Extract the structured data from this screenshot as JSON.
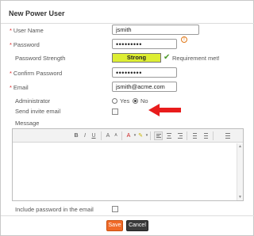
{
  "dialog": {
    "title": "New Power User"
  },
  "form": {
    "user_name": {
      "label": "User Name",
      "required_mark": "*",
      "value": "jsmith"
    },
    "password": {
      "label": "Password",
      "required_mark": "*",
      "value": "•••••••••"
    },
    "password_strength": {
      "label": "Password Strength",
      "strength": "Strong",
      "requirement_text": "Requirement met!"
    },
    "confirm_password": {
      "label": "Confirm Password",
      "required_mark": "*",
      "value": "•••••••••"
    },
    "email": {
      "label": "Email",
      "required_mark": "*",
      "value": "jsmith@acme.com"
    },
    "administrator": {
      "label": "Administrator",
      "options": [
        "Yes",
        "No"
      ],
      "selected": "No"
    },
    "send_invite": {
      "label": "Send invite email",
      "checked": false
    },
    "message": {
      "label": "Message",
      "value": ""
    },
    "include_password": {
      "label": "Include password in the email",
      "checked": false
    }
  },
  "editor_toolbar": {
    "bold": "B",
    "italic": "I",
    "underline": "U",
    "font_size": "A",
    "font_color": "A"
  },
  "buttons": {
    "save": "Save",
    "cancel": "Cancel"
  },
  "colors": {
    "required": "#dd2222",
    "strength_fill": "#ddee33",
    "save_button": "#f06a28",
    "cancel_button": "#3b3b3b",
    "arrow": "#e81c1c"
  }
}
